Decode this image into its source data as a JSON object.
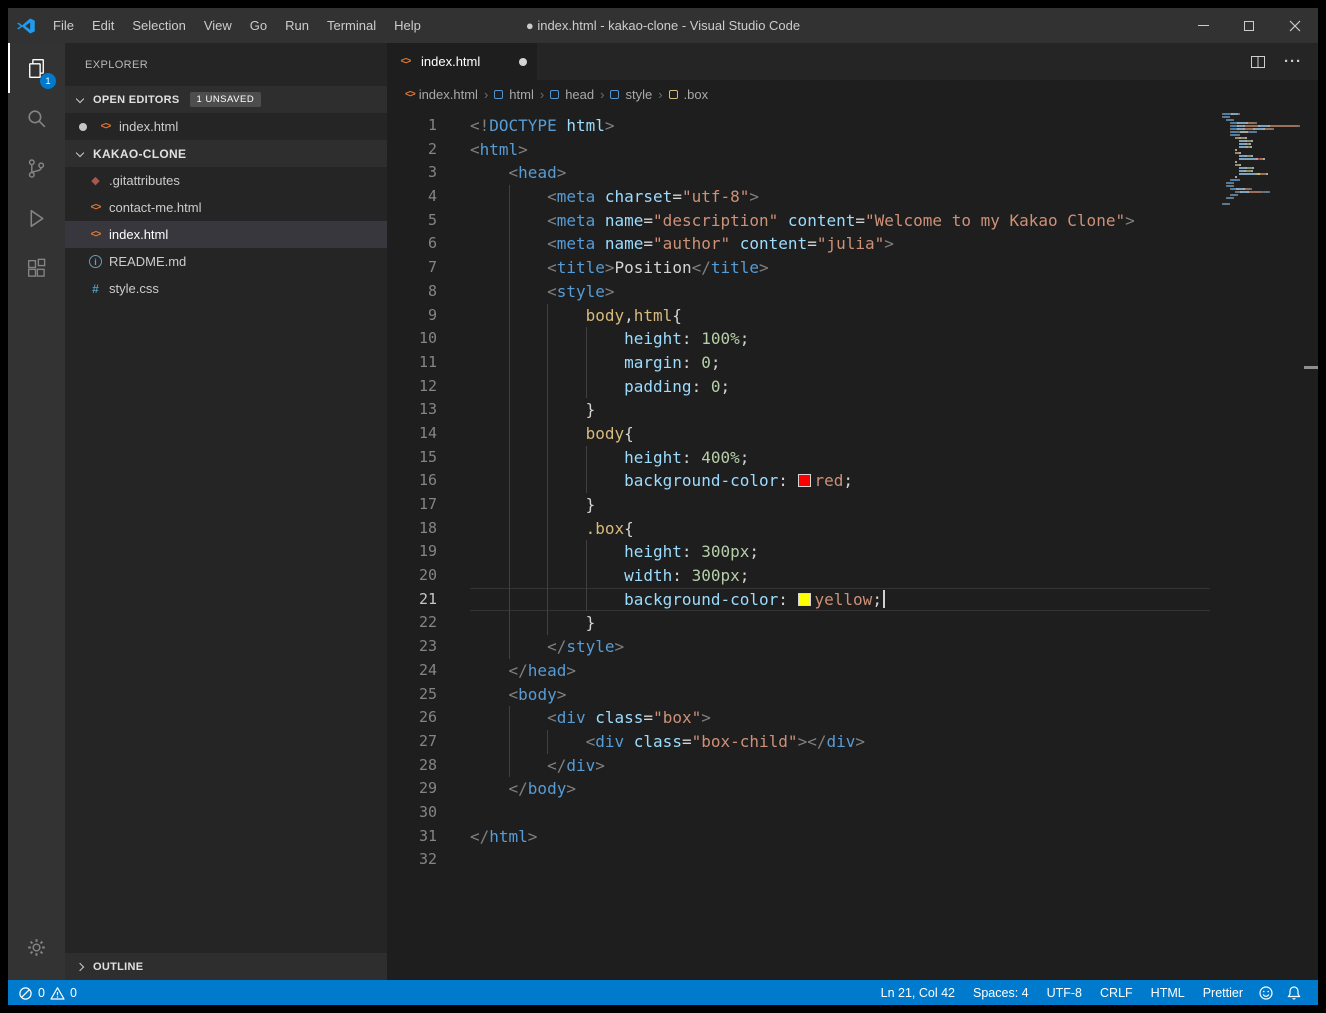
{
  "window": {
    "title": "● index.html - kakao-clone - Visual Studio Code"
  },
  "menu": [
    "File",
    "Edit",
    "Selection",
    "View",
    "Go",
    "Run",
    "Terminal",
    "Help"
  ],
  "activity_bar": {
    "explorer_badge": "1"
  },
  "icons": {
    "html_file": "<>",
    "css_file": "#",
    "git_file": "◆",
    "readme_info": "i",
    "more_actions": "···",
    "crumb_sep": "›"
  },
  "sidebar": {
    "explorer_title": "EXPLORER",
    "open_editors": {
      "label": "OPEN EDITORS",
      "badge": "1 UNSAVED",
      "items": [
        {
          "name": "index.html",
          "icon": "html",
          "dirty": true
        }
      ]
    },
    "folder": {
      "label": "KAKAO-CLONE",
      "files": [
        {
          "name": ".gitattributes",
          "icon": "git",
          "selected": false
        },
        {
          "name": "contact-me.html",
          "icon": "html",
          "selected": false
        },
        {
          "name": "index.html",
          "icon": "html",
          "selected": true
        },
        {
          "name": "README.md",
          "icon": "info",
          "selected": false
        },
        {
          "name": "style.css",
          "icon": "css",
          "selected": false
        }
      ]
    },
    "outline_label": "OUTLINE"
  },
  "editor": {
    "tab": {
      "label": "index.html",
      "dirty": true
    },
    "breadcrumbs": [
      {
        "label": "index.html",
        "icon": "file-html"
      },
      {
        "label": "html",
        "icon": "symbol"
      },
      {
        "label": "head",
        "icon": "symbol"
      },
      {
        "label": "style",
        "icon": "symbol"
      },
      {
        "label": ".box",
        "icon": "symbol-class"
      }
    ],
    "code": {
      "lines": [
        {
          "n": 1,
          "i": 0,
          "t": [
            [
              "p",
              "<!"
            ],
            [
              "t",
              "DOCTYPE"
            ],
            [
              "w",
              " "
            ],
            [
              "a",
              "html"
            ],
            [
              "p",
              ">"
            ]
          ]
        },
        {
          "n": 2,
          "i": 0,
          "t": [
            [
              "p",
              "<"
            ],
            [
              "t",
              "html"
            ],
            [
              "p",
              ">"
            ]
          ]
        },
        {
          "n": 3,
          "i": 4,
          "t": [
            [
              "p",
              "<"
            ],
            [
              "t",
              "head"
            ],
            [
              "p",
              ">"
            ]
          ]
        },
        {
          "n": 4,
          "i": 8,
          "t": [
            [
              "p",
              "<"
            ],
            [
              "t",
              "meta"
            ],
            [
              "w",
              " "
            ],
            [
              "a",
              "charset"
            ],
            [
              "w",
              "="
            ],
            [
              "s",
              "\"utf-8\""
            ],
            [
              "p",
              ">"
            ]
          ]
        },
        {
          "n": 5,
          "i": 8,
          "t": [
            [
              "p",
              "<"
            ],
            [
              "t",
              "meta"
            ],
            [
              "w",
              " "
            ],
            [
              "a",
              "name"
            ],
            [
              "w",
              "="
            ],
            [
              "s",
              "\"description\""
            ],
            [
              "w",
              " "
            ],
            [
              "a",
              "content"
            ],
            [
              "w",
              "="
            ],
            [
              "s",
              "\"Welcome to my Kakao Clone\""
            ],
            [
              "p",
              ">"
            ]
          ]
        },
        {
          "n": 6,
          "i": 8,
          "t": [
            [
              "p",
              "<"
            ],
            [
              "t",
              "meta"
            ],
            [
              "w",
              " "
            ],
            [
              "a",
              "name"
            ],
            [
              "w",
              "="
            ],
            [
              "s",
              "\"author\""
            ],
            [
              "w",
              " "
            ],
            [
              "a",
              "content"
            ],
            [
              "w",
              "="
            ],
            [
              "s",
              "\"julia\""
            ],
            [
              "p",
              ">"
            ]
          ]
        },
        {
          "n": 7,
          "i": 8,
          "t": [
            [
              "p",
              "<"
            ],
            [
              "t",
              "title"
            ],
            [
              "p",
              ">"
            ],
            [
              "w",
              "Position"
            ],
            [
              "p",
              "</"
            ],
            [
              "t",
              "title"
            ],
            [
              "p",
              ">"
            ]
          ]
        },
        {
          "n": 8,
          "i": 8,
          "t": [
            [
              "p",
              "<"
            ],
            [
              "t",
              "style"
            ],
            [
              "p",
              ">"
            ]
          ]
        },
        {
          "n": 9,
          "i": 12,
          "t": [
            [
              "sel",
              "body"
            ],
            [
              "w",
              ","
            ],
            [
              "sel",
              "html"
            ],
            [
              "w",
              "{"
            ]
          ]
        },
        {
          "n": 10,
          "i": 16,
          "t": [
            [
              "prop",
              "height"
            ],
            [
              "w",
              ": "
            ],
            [
              "n",
              "100%"
            ],
            [
              "w",
              ";"
            ]
          ]
        },
        {
          "n": 11,
          "i": 16,
          "t": [
            [
              "prop",
              "margin"
            ],
            [
              "w",
              ": "
            ],
            [
              "n",
              "0"
            ],
            [
              "w",
              ";"
            ]
          ]
        },
        {
          "n": 12,
          "i": 16,
          "t": [
            [
              "prop",
              "padding"
            ],
            [
              "w",
              ": "
            ],
            [
              "n",
              "0"
            ],
            [
              "w",
              ";"
            ]
          ]
        },
        {
          "n": 13,
          "i": 12,
          "t": [
            [
              "w",
              "}"
            ]
          ]
        },
        {
          "n": 14,
          "i": 12,
          "t": [
            [
              "sel",
              "body"
            ],
            [
              "w",
              "{"
            ]
          ]
        },
        {
          "n": 15,
          "i": 16,
          "t": [
            [
              "prop",
              "height"
            ],
            [
              "w",
              ": "
            ],
            [
              "n",
              "400%"
            ],
            [
              "w",
              ";"
            ]
          ]
        },
        {
          "n": 16,
          "i": 16,
          "t": [
            [
              "prop",
              "background-color"
            ],
            [
              "w",
              ": "
            ],
            [
              "swr",
              ""
            ],
            [
              "s",
              "red"
            ],
            [
              "w",
              ";"
            ]
          ]
        },
        {
          "n": 17,
          "i": 12,
          "t": [
            [
              "w",
              "}"
            ]
          ]
        },
        {
          "n": 18,
          "i": 12,
          "t": [
            [
              "sel",
              ".box"
            ],
            [
              "w",
              "{"
            ]
          ]
        },
        {
          "n": 19,
          "i": 16,
          "t": [
            [
              "prop",
              "height"
            ],
            [
              "w",
              ": "
            ],
            [
              "n",
              "300px"
            ],
            [
              "w",
              ";"
            ]
          ]
        },
        {
          "n": 20,
          "i": 16,
          "t": [
            [
              "prop",
              "width"
            ],
            [
              "w",
              ": "
            ],
            [
              "n",
              "300px"
            ],
            [
              "w",
              ";"
            ]
          ]
        },
        {
          "n": 21,
          "i": 16,
          "cur": true,
          "t": [
            [
              "prop",
              "background-color"
            ],
            [
              "w",
              ": "
            ],
            [
              "swy",
              ""
            ],
            [
              "s",
              "yellow"
            ],
            [
              "w",
              ";"
            ],
            [
              "cursor",
              ""
            ]
          ]
        },
        {
          "n": 22,
          "i": 12,
          "t": [
            [
              "w",
              "}"
            ]
          ]
        },
        {
          "n": 23,
          "i": 8,
          "t": [
            [
              "p",
              "</"
            ],
            [
              "t",
              "style"
            ],
            [
              "p",
              ">"
            ]
          ]
        },
        {
          "n": 24,
          "i": 4,
          "t": [
            [
              "p",
              "</"
            ],
            [
              "t",
              "head"
            ],
            [
              "p",
              ">"
            ]
          ]
        },
        {
          "n": 25,
          "i": 4,
          "t": [
            [
              "p",
              "<"
            ],
            [
              "t",
              "body"
            ],
            [
              "p",
              ">"
            ]
          ]
        },
        {
          "n": 26,
          "i": 8,
          "t": [
            [
              "p",
              "<"
            ],
            [
              "t",
              "div"
            ],
            [
              "w",
              " "
            ],
            [
              "a",
              "class"
            ],
            [
              "w",
              "="
            ],
            [
              "s",
              "\"box\""
            ],
            [
              "p",
              ">"
            ]
          ]
        },
        {
          "n": 27,
          "i": 12,
          "t": [
            [
              "p",
              "<"
            ],
            [
              "t",
              "div"
            ],
            [
              "w",
              " "
            ],
            [
              "a",
              "class"
            ],
            [
              "w",
              "="
            ],
            [
              "s",
              "\"box-child\""
            ],
            [
              "p",
              ">"
            ],
            [
              "p",
              "</"
            ],
            [
              "t",
              "div"
            ],
            [
              "p",
              ">"
            ]
          ]
        },
        {
          "n": 28,
          "i": 8,
          "t": [
            [
              "p",
              "</"
            ],
            [
              "t",
              "div"
            ],
            [
              "p",
              ">"
            ]
          ]
        },
        {
          "n": 29,
          "i": 4,
          "t": [
            [
              "p",
              "</"
            ],
            [
              "t",
              "body"
            ],
            [
              "p",
              ">"
            ]
          ]
        },
        {
          "n": 30,
          "i": 0,
          "t": []
        },
        {
          "n": 31,
          "i": 0,
          "t": [
            [
              "p",
              "</"
            ],
            [
              "t",
              "html"
            ],
            [
              "p",
              ">"
            ]
          ]
        },
        {
          "n": 32,
          "i": 0,
          "t": []
        }
      ]
    }
  },
  "status_bar": {
    "errors": "0",
    "warnings": "0",
    "items": [
      "Ln 21, Col 42",
      "Spaces: 4",
      "UTF-8",
      "CRLF",
      "HTML",
      "Prettier"
    ]
  },
  "colors": {
    "accent": "#007acc",
    "swatch_red": "#ff0000",
    "swatch_yellow": "#ffff00",
    "html_icon": "#e37933"
  }
}
